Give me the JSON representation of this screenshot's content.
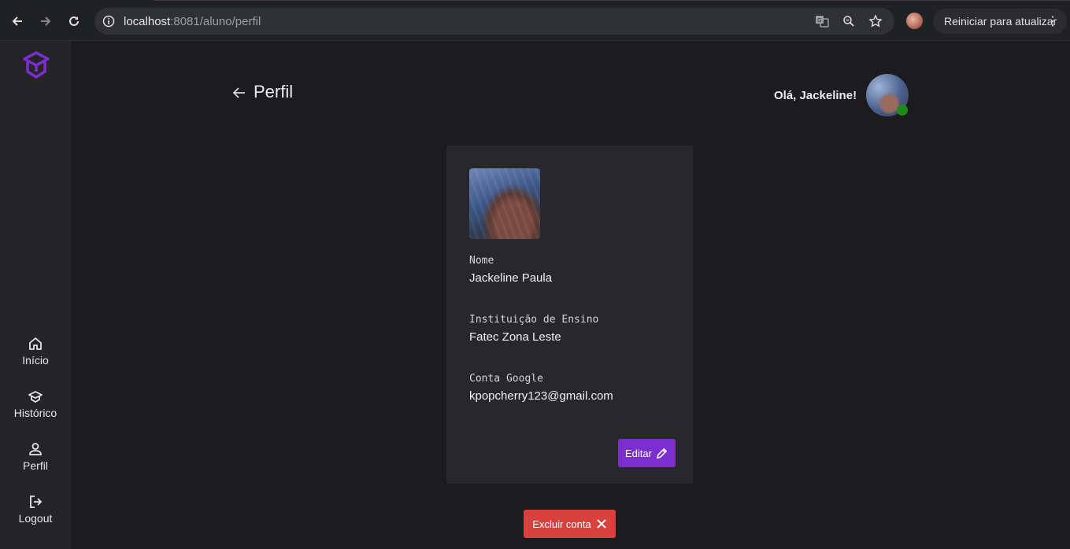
{
  "browser": {
    "url_host": "localhost",
    "url_rest": ":8081/aluno/perfil",
    "update_label": "Reiniciar para atualizar"
  },
  "sidebar": {
    "items": [
      {
        "label": "Início",
        "icon": "home-icon"
      },
      {
        "label": "Histórico",
        "icon": "graduation-cap-icon"
      },
      {
        "label": "Perfil",
        "icon": "user-icon"
      },
      {
        "label": "Logout",
        "icon": "logout-icon"
      }
    ]
  },
  "header": {
    "title": "Perfil",
    "greeting": "Olá, Jackeline!"
  },
  "profile": {
    "fields": [
      {
        "label": "Nome",
        "value": "Jackeline Paula"
      },
      {
        "label": "Instituição de Ensino",
        "value": "Fatec Zona Leste"
      },
      {
        "label": "Conta Google",
        "value": "kpopcherry123@gmail.com"
      }
    ],
    "edit_label": "Editar",
    "delete_label": "Excluir conta"
  },
  "colors": {
    "accent": "#7b2fd0",
    "danger": "#d9413f",
    "online": "#1f8a1a",
    "background": "#1c1b1f",
    "sidebar": "#252428",
    "card": "#28272b"
  }
}
